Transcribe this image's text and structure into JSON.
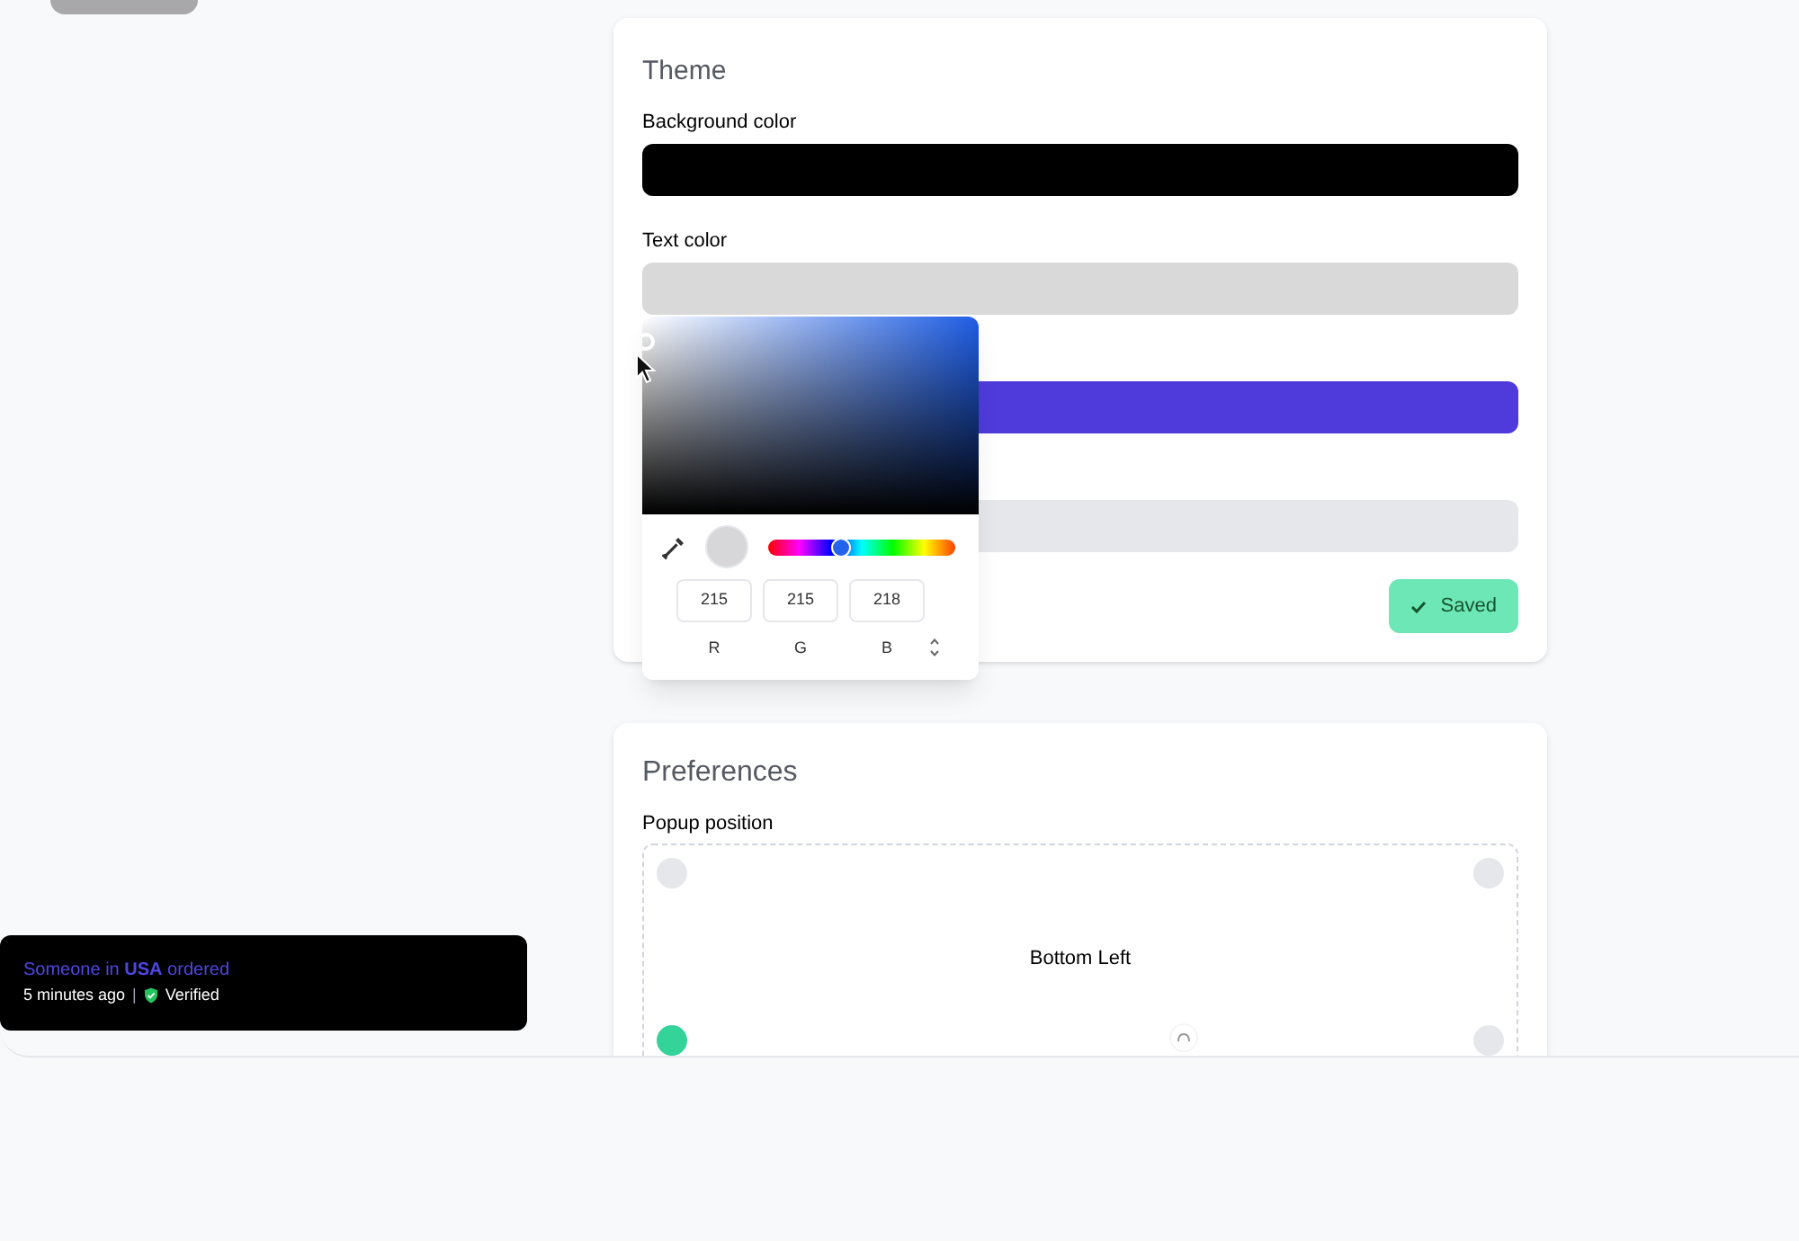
{
  "theme": {
    "title": "Theme",
    "fields": [
      {
        "label": "Background color",
        "color": "#000000"
      },
      {
        "label": "Text color",
        "color": "#d9d9d9"
      },
      {
        "color": "#4f3bdb"
      },
      {
        "color": "#e5e7eb"
      }
    ],
    "save_button": {
      "label": "Saved"
    }
  },
  "color_picker": {
    "hue": {
      "level": 0.38
    },
    "channels": [
      {
        "label": "R",
        "value": "215"
      },
      {
        "label": "G",
        "value": "215"
      },
      {
        "label": "B",
        "value": "218"
      }
    ]
  },
  "preferences": {
    "title": "Preferences",
    "popup_position": {
      "label": "Popup position",
      "current": "Bottom Left",
      "positions": [
        {
          "selected": false
        },
        {
          "selected": false
        },
        {
          "selected": true
        },
        {
          "selected": false
        }
      ]
    }
  },
  "toast": {
    "headline": "Someone in **USA** ordered",
    "time": "5 minutes ago",
    "separator": "|",
    "badge": "Verified"
  }
}
